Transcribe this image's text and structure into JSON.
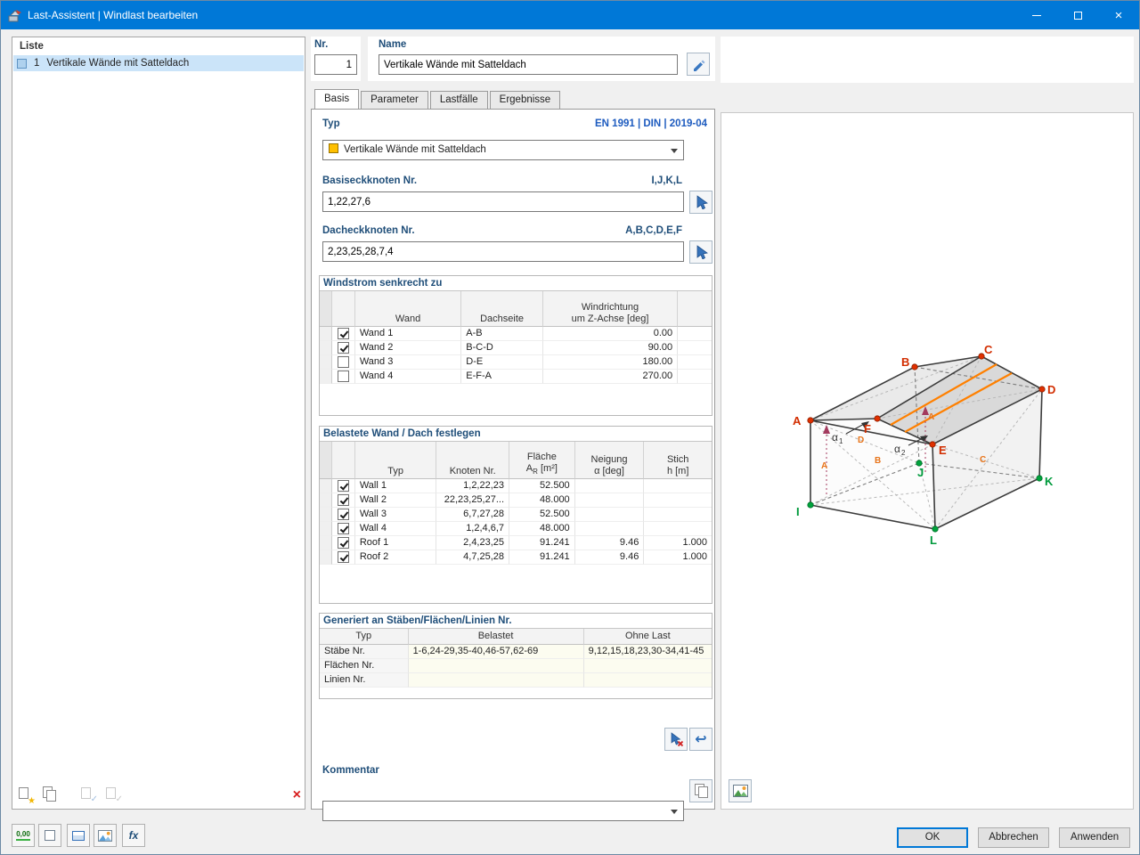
{
  "window": {
    "title": "Last-Assistent | Windlast bearbeiten"
  },
  "titlebar_controls": {
    "close": "×"
  },
  "icons": {
    "star": "★",
    "check": "✓",
    "delete": "×",
    "undo": "↩",
    "fx": "fx",
    "decimals": "0,00"
  },
  "liste": {
    "header": "Liste",
    "item": {
      "nr": "1",
      "label": "Vertikale Wände mit Satteldach"
    }
  },
  "header": {
    "nr_label": "Nr.",
    "nr_value": "1",
    "name_label": "Name",
    "name_value": "Vertikale Wände mit Satteldach"
  },
  "tabs": {
    "basis": "Basis",
    "parameter": "Parameter",
    "lastfaelle": "Lastfälle",
    "ergebnisse": "Ergebnisse"
  },
  "basis": {
    "typ_label": "Typ",
    "norm": "EN 1991 | DIN | 2019-04",
    "typ_value": "Vertikale Wände mit Satteldach",
    "basis_nodes": {
      "label": "Basiseckknoten Nr.",
      "letters": "I,J,K,L",
      "value": "1,22,27,6"
    },
    "dach_nodes": {
      "label": "Dacheckknoten Nr.",
      "letters": "A,B,C,D,E,F",
      "value": "2,23,25,28,7,4"
    },
    "wind": {
      "title": "Windstrom senkrecht zu",
      "h_wand": "Wand",
      "h_dachseite": "Dachseite",
      "h_wr1": "Windrichtung",
      "h_wr2": "um Z-Achse [deg]",
      "rows": [
        {
          "checked": true,
          "wand": "Wand 1",
          "dachseite": "A-B",
          "deg": "0.00"
        },
        {
          "checked": true,
          "wand": "Wand 2",
          "dachseite": "B-C-D",
          "deg": "90.00"
        },
        {
          "checked": false,
          "wand": "Wand 3",
          "dachseite": "D-E",
          "deg": "180.00"
        },
        {
          "checked": false,
          "wand": "Wand 4",
          "dachseite": "E-F-A",
          "deg": "270.00"
        }
      ]
    },
    "belastet": {
      "title": "Belastete Wand / Dach festlegen",
      "h_typ": "Typ",
      "h_knoten": "Knoten Nr.",
      "h_fl1": "Fläche",
      "h_fl_sym": "A",
      "h_fl_sub": "R",
      "h_fl_unit": "[m²]",
      "h_ne1": "Neigung",
      "h_ne2": "α [deg]",
      "h_st1": "Stich",
      "h_st2": "h [m]",
      "rows": [
        {
          "checked": true,
          "typ": "Wall 1",
          "knoten": "1,2,22,23",
          "flaeche": "52.500",
          "neigung": "",
          "stich": ""
        },
        {
          "checked": true,
          "typ": "Wall 2",
          "knoten": "22,23,25,27...",
          "flaeche": "48.000",
          "neigung": "",
          "stich": ""
        },
        {
          "checked": true,
          "typ": "Wall 3",
          "knoten": "6,7,27,28",
          "flaeche": "52.500",
          "neigung": "",
          "stich": ""
        },
        {
          "checked": true,
          "typ": "Wall 4",
          "knoten": "1,2,4,6,7",
          "flaeche": "48.000",
          "neigung": "",
          "stich": ""
        },
        {
          "checked": true,
          "typ": "Roof 1",
          "knoten": "2,4,23,25",
          "flaeche": "91.241",
          "neigung": "9.46",
          "stich": "1.000"
        },
        {
          "checked": true,
          "typ": "Roof 2",
          "knoten": "4,7,25,28",
          "flaeche": "91.241",
          "neigung": "9.46",
          "stich": "1.000"
        }
      ]
    },
    "generiert": {
      "title": "Generiert an Stäben/Flächen/Linien Nr.",
      "h_typ": "Typ",
      "h_belastet": "Belastet",
      "h_ohne": "Ohne Last",
      "rows": [
        {
          "typ": "Stäbe Nr.",
          "belastet": "1-6,24-29,35-40,46-57,62-69",
          "ohne": "9,12,15,18,23,30-34,41-45"
        },
        {
          "typ": "Flächen Nr.",
          "belastet": "",
          "ohne": ""
        },
        {
          "typ": "Linien Nr.",
          "belastet": "",
          "ohne": ""
        }
      ]
    },
    "kommentar_label": "Kommentar"
  },
  "graphic": {
    "nodes": {
      "a": "A",
      "b": "B",
      "c": "C",
      "d": "D",
      "e": "E",
      "f": "F",
      "i": "I",
      "j": "J",
      "k": "K",
      "l": "L"
    },
    "alpha1_sym": "α",
    "alpha1_idx": "1",
    "alpha2_sym": "α",
    "alpha2_idx": "2",
    "marks": {
      "m0": "A",
      "m1": "D",
      "m2": "B",
      "m3": "C",
      "m4": "A"
    }
  },
  "footer": {
    "ok": "OK",
    "cancel": "Abbrechen",
    "apply": "Anwenden"
  },
  "colors": {
    "accent": "#0078d7",
    "node_red": "#d22d00",
    "node_green": "#00a040",
    "load_orange": "#ff8000",
    "type_yellow": "#ffc000"
  }
}
